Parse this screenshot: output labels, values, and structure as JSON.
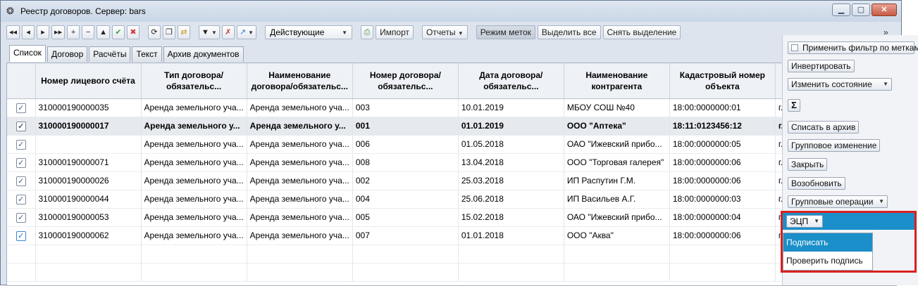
{
  "window": {
    "title": "Реестр договоров. Сервер: bars"
  },
  "toolbar": {
    "nav_first": "◂◂",
    "nav_prev": "◂",
    "nav_next": "▸",
    "nav_last": "▸▸",
    "add": "+",
    "remove": "−",
    "up": "▲",
    "ok": "✔",
    "cancel": "✖",
    "refresh": "⟳",
    "copy": "❐",
    "paste": "⇄",
    "filter": "▼",
    "clear_filter": "✗",
    "arrow": "↗",
    "status_combo": "Действующие",
    "import_label": "Импорт",
    "reports_label": "Отчеты",
    "mark_mode_label": "Режим меток",
    "select_all_label": "Выделить все",
    "clear_selection_label": "Снять выделение",
    "more": "»"
  },
  "tabs": [
    "Список",
    "Договор",
    "Расчёты",
    "Текст",
    "Архив документов"
  ],
  "table": {
    "headers": [
      "Номер лицевого счёта",
      "Тип договора/обязательс...",
      "Наименование договора/обязательс...",
      "Номер договора/обязательс...",
      "Дата договора/обязательс...",
      "Наименование контрагента",
      "Кадастровый номер объекта",
      ""
    ],
    "rows": [
      {
        "checked": "✓",
        "account": "310000190000035",
        "type": "Аренда земельного уча...",
        "name": "Аренда земельного уча...",
        "number": "003",
        "date": "10.01.2019",
        "contractor": "МБОУ СОШ №40",
        "cadastre": "18:00:0000000:01",
        "extra": "г."
      },
      {
        "checked": "✓",
        "account": "310000190000017",
        "type": "Аренда земельного у...",
        "name": "Аренда земельного у...",
        "number": "001",
        "date": "01.01.2019",
        "contractor": "ООО \"Аптека\"",
        "cadastre": "18:11:0123456:12",
        "extra": "г."
      },
      {
        "checked": "✓",
        "account": "",
        "type": "Аренда земельного уча...",
        "name": "Аренда земельного уча...",
        "number": "006",
        "date": "01.05.2018",
        "contractor": "ОАО \"Ижевский прибо...",
        "cadastre": "18:00:0000000:05",
        "extra": "г."
      },
      {
        "checked": "✓",
        "account": "310000190000071",
        "type": "Аренда земельного уча...",
        "name": "Аренда земельного уча...",
        "number": "008",
        "date": "13.04.2018",
        "contractor": "ООО \"Торговая галерея\"",
        "cadastre": "18:00:0000000:06",
        "extra": "г."
      },
      {
        "checked": "✓",
        "account": "310000190000026",
        "type": "Аренда земельного уча...",
        "name": "Аренда земельного уча...",
        "number": "002",
        "date": "25.03.2018",
        "contractor": "ИП Распутин Г.М.",
        "cadastre": "18:00:0000000:06",
        "extra": "г."
      },
      {
        "checked": "✓",
        "account": "310000190000044",
        "type": "Аренда земельного уча...",
        "name": "Аренда земельного уча...",
        "number": "004",
        "date": "25.06.2018",
        "contractor": "ИП Васильев А.Г.",
        "cadastre": "18:00:0000000:03",
        "extra": "г."
      },
      {
        "checked": "✓",
        "account": "310000190000053",
        "type": "Аренда земельного уча...",
        "name": "Аренда земельного уча...",
        "number": "005",
        "date": "15.02.2018",
        "contractor": "ОАО \"Ижевский прибо...",
        "cadastre": "18:00:0000000:04",
        "extra": "г."
      },
      {
        "checked": "✓",
        "account": "310000190000062",
        "type": "Аренда земельного уча...",
        "name": "Аренда земельного уча...",
        "number": "007",
        "date": "01.01.2018",
        "contractor": "ООО \"Аква\"",
        "cadastre": "18:00:0000000:06",
        "extra": "г."
      }
    ]
  },
  "side_panel": {
    "apply_filter_label": "Применить фильтр по меткам",
    "invert_label": "Инвертировать",
    "change_state_label": "Изменить состояние",
    "sum_label": "Σ",
    "archive_label": "Списать в архив",
    "group_change_label": "Групповое изменение",
    "close_label": "Закрыть",
    "resume_label": "Возобновить",
    "group_ops_label": "Групповые операции",
    "ecp_label": "ЭЦП",
    "ecp_menu": [
      "Подписать",
      "Проверить подпись"
    ]
  },
  "colors": {
    "highlight": "#d9211f",
    "selection": "#1b8fc9"
  }
}
